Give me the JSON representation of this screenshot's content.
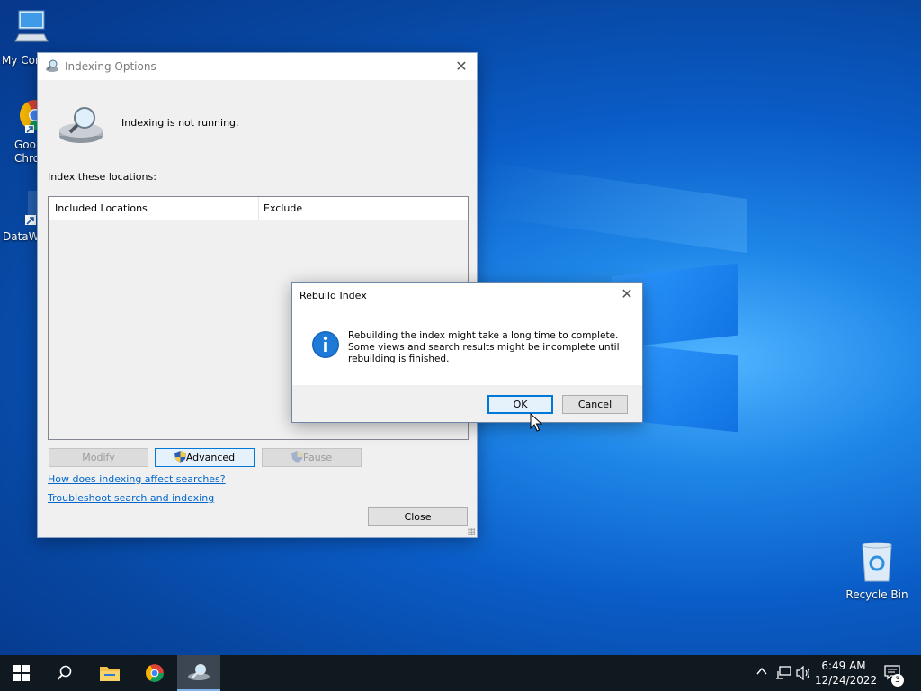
{
  "desktop": {
    "icons": [
      {
        "label": "My Cor"
      },
      {
        "label": "Goo Chro"
      },
      {
        "label": "DataW"
      },
      {
        "label": "Recycle Bin"
      }
    ]
  },
  "indexing_window": {
    "title": "Indexing Options",
    "status": "Indexing is not running.",
    "locations_label": "Index these locations:",
    "columns": [
      "Included Locations",
      "Exclude"
    ],
    "buttons": {
      "modify": "Modify",
      "advanced": "Advanced",
      "pause": "Pause",
      "close": "Close"
    },
    "links": {
      "how": "How does indexing affect searches?",
      "troubleshoot": "Troubleshoot search and indexing"
    }
  },
  "rebuild_dialog": {
    "title": "Rebuild Index",
    "message": "Rebuilding the index might take a long time to complete.\nSome views and search results might be incomplete until\nrebuilding is finished.",
    "ok": "OK",
    "cancel": "Cancel"
  },
  "taskbar": {
    "time": "6:49 AM",
    "date": "12/24/2022",
    "notification_count": "3"
  }
}
